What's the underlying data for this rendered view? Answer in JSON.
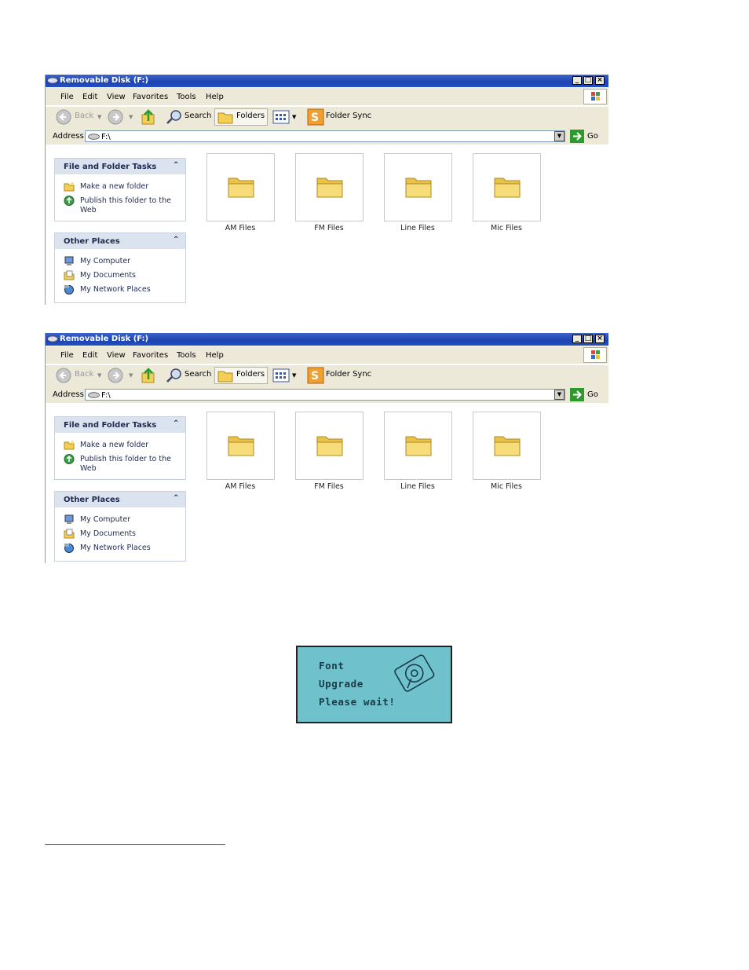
{
  "windows": [
    {
      "title": "Removable Disk (F:)",
      "menu": [
        "File",
        "Edit",
        "View",
        "Favorites",
        "Tools",
        "Help"
      ],
      "toolbar": {
        "back": "Back",
        "search": "Search",
        "folders": "Folders",
        "folder_sync": "Folder Sync"
      },
      "address": {
        "label": "Address",
        "value": "F:\\",
        "go": "Go"
      },
      "file_tasks": {
        "title": "File and Folder Tasks",
        "items": [
          "Make a new folder",
          "Publish this folder to the Web"
        ]
      },
      "other_places": {
        "title": "Other Places",
        "items": [
          "My Computer",
          "My Documents",
          "My Network Places"
        ]
      },
      "folders": [
        "AM Files",
        "FM Files",
        "Line Files",
        "Mic Files"
      ]
    },
    {
      "title": "Removable Disk (F:)",
      "menu": [
        "File",
        "Edit",
        "View",
        "Favorites",
        "Tools",
        "Help"
      ],
      "toolbar": {
        "back": "Back",
        "search": "Search",
        "folders": "Folders",
        "folder_sync": "Folder Sync"
      },
      "address": {
        "label": "Address",
        "value": "F:\\",
        "go": "Go"
      },
      "file_tasks": {
        "title": "File and Folder Tasks",
        "items": [
          "Make a new folder",
          "Publish this folder to the Web"
        ]
      },
      "other_places": {
        "title": "Other Places",
        "items": [
          "My Computer",
          "My Documents",
          "My Network Places"
        ]
      },
      "folders": [
        "AM Files",
        "FM Files",
        "Line Files",
        "Mic Files"
      ]
    }
  ],
  "lcd": {
    "lines": [
      "Font",
      "Upgrade",
      "Please wait!"
    ]
  },
  "colors": {
    "titlebar": "#1c43b0",
    "lcd_background": "#6fc2cc",
    "folder": "#f5d66a"
  }
}
